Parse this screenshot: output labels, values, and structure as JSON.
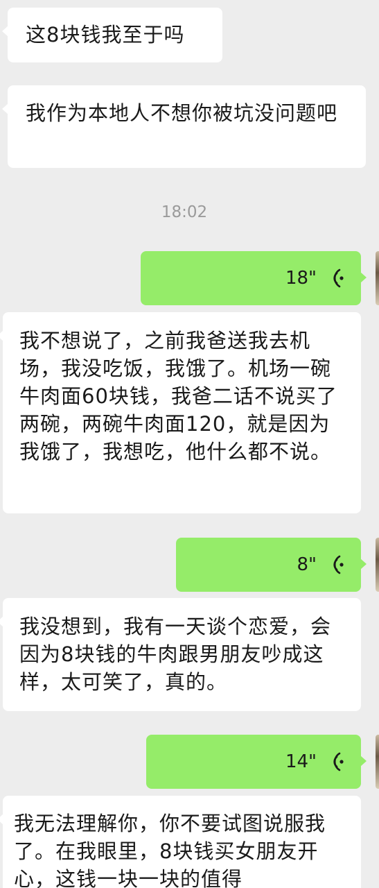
{
  "messages": {
    "m1": "这8块钱我至于吗",
    "m2": "我作为本地人不想你被坑没问题吧",
    "time": "18:02",
    "v1": "18\"",
    "m3": "我不想说了，之前我爸送我去机场，我没吃饭，我饿了。机场一碗牛肉面60块钱，我爸二话不说买了两碗，两碗牛肉面120，就是因为我饿了，我想吃，他什么都不说。",
    "v2": "8\"",
    "m4": "我没想到，我有一天谈个恋爱，会因为8块钱的牛肉跟男朋友吵成这样，太可笑了，真的。",
    "v3": "14\"",
    "m5": "我无法理解你，你不要试图说服我了。在我眼里，8块钱买女朋友开心，这钱一块一块的值得"
  },
  "colors": {
    "background": "#ededed",
    "incoming_bubble": "#ffffff",
    "outgoing_voice_bubble": "#95ec69",
    "timestamp": "#9a9a9a"
  },
  "icons": {
    "voice": "voice-wave-icon"
  }
}
